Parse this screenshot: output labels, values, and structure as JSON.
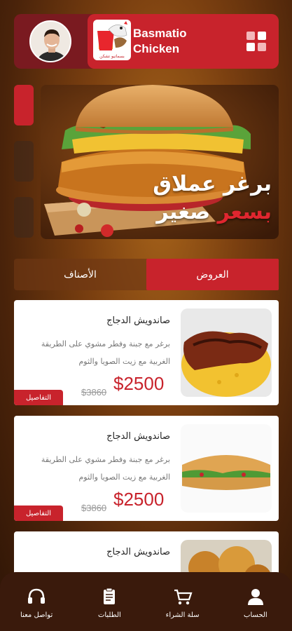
{
  "header": {
    "brand_name": "Basmatio Chicken",
    "logo_text": "بسماتيو تشكن"
  },
  "banner": {
    "line1": "برغر عملاق",
    "line2_red": "بسعر",
    "line2_white": "صغير",
    "slide_count": 3,
    "active_slide": 1
  },
  "tabs": [
    {
      "label": "العروض",
      "active": true
    },
    {
      "label": "الأصناف",
      "active": false
    }
  ],
  "products": [
    {
      "title": "صاندويش الدجاج",
      "description": "برغر مع جبنة وفطر مشوي على الطريقة الغربية مع زيت الصويا والثوم",
      "price": "$2500",
      "old_price": "$3860",
      "details_label": "التفاصيل",
      "image": "grilled-chicken-rice"
    },
    {
      "title": "صاندويش الدجاج",
      "description": "برغر مع جبنة وفطر مشوي على الطريقة الغربية مع زيت الصويا والثوم",
      "price": "$2500",
      "old_price": "$3860",
      "details_label": "التفاصيل",
      "image": "sub-sandwich"
    },
    {
      "title": "صاندويش الدجاج",
      "image": "fried-chicken"
    }
  ],
  "bottom_nav": [
    {
      "label": "الحساب",
      "icon": "user-icon"
    },
    {
      "label": "سلة الشراء",
      "icon": "cart-icon"
    },
    {
      "label": "الطلبات",
      "icon": "clipboard-icon"
    },
    {
      "label": "تواصل معنا",
      "icon": "headset-icon"
    }
  ],
  "colors": {
    "accent": "#c8232c",
    "nav_bg": "#3a1a0c"
  }
}
